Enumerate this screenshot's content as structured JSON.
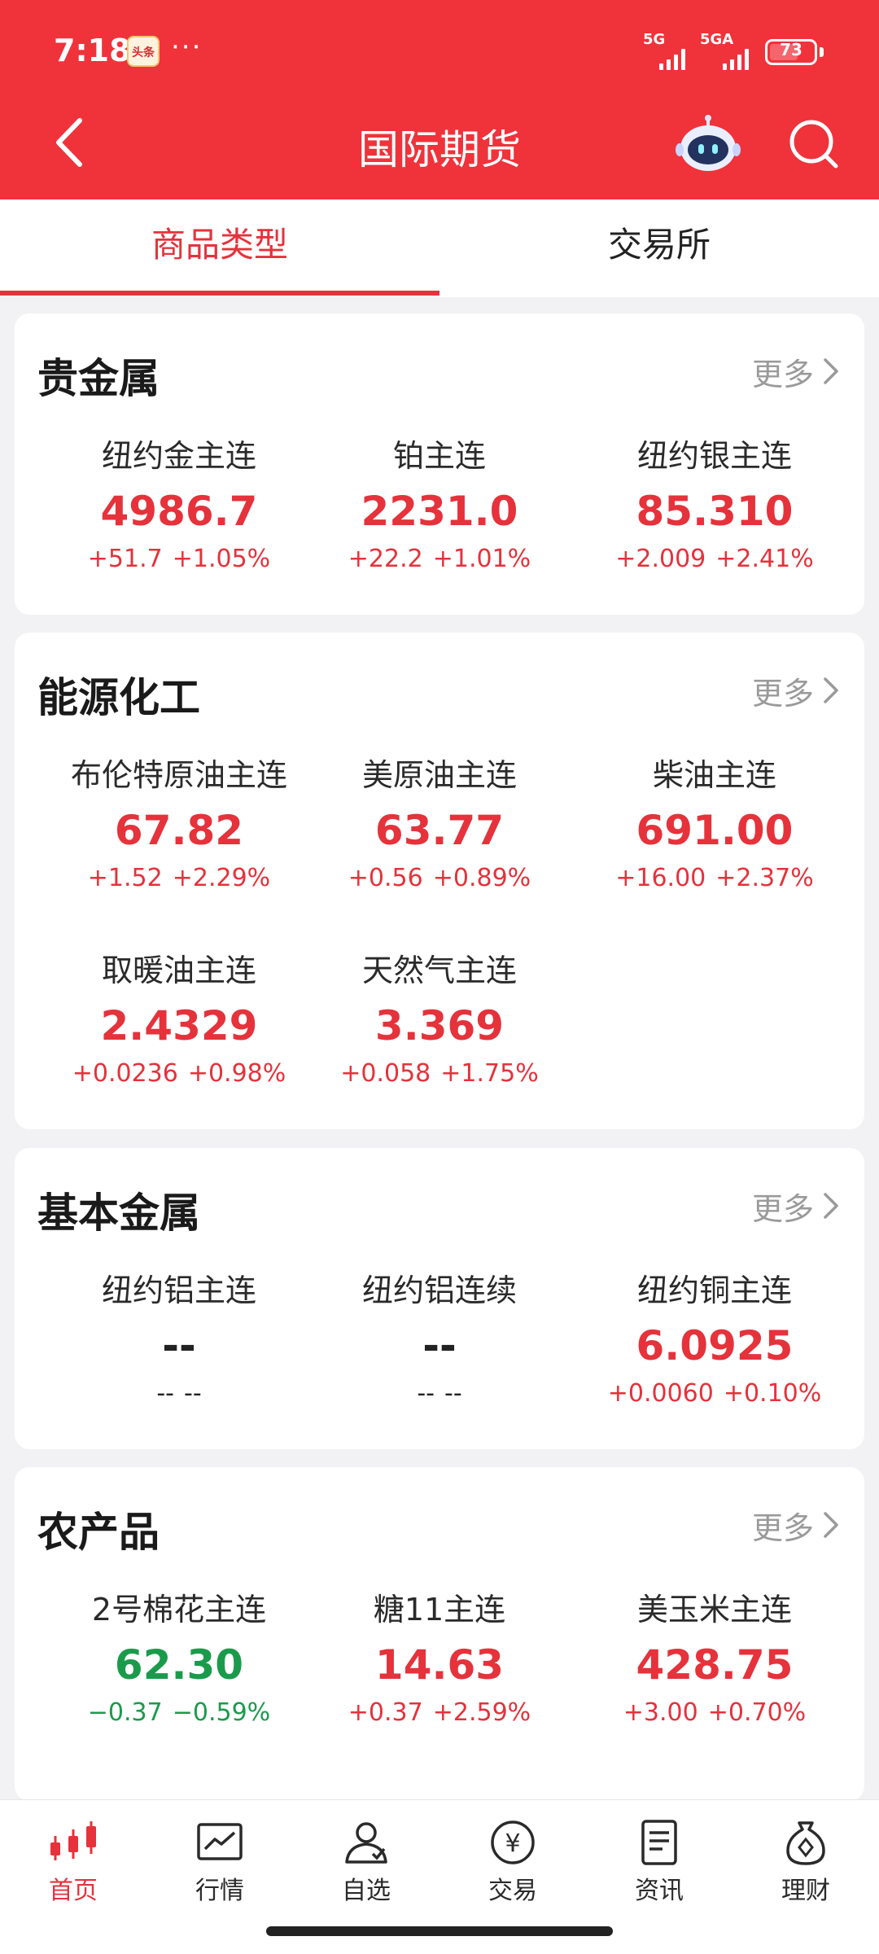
{
  "status_bar": {
    "time": "7:18",
    "app_badge": "头条",
    "dots": "···",
    "signal1": "5G",
    "signal2": "5GA",
    "battery": "73"
  },
  "header": {
    "title": "国际期货"
  },
  "tabs": [
    {
      "label": "商品类型",
      "active": true
    },
    {
      "label": "交易所",
      "active": false
    }
  ],
  "colors": {
    "up": "#e5323b",
    "down": "#1a9b4b",
    "flat": "#222222",
    "accent": "#f0323b"
  },
  "sections": [
    {
      "title": "贵金属",
      "more": "更多",
      "items": [
        {
          "name": "纽约金主连",
          "price": "4986.7",
          "change": "+51.7",
          "pct": "+1.05%",
          "trend": "up"
        },
        {
          "name": "铂主连",
          "price": "2231.0",
          "change": "+22.2",
          "pct": "+1.01%",
          "trend": "up"
        },
        {
          "name": "纽约银主连",
          "price": "85.310",
          "change": "+2.009",
          "pct": "+2.41%",
          "trend": "up"
        }
      ]
    },
    {
      "title": "能源化工",
      "more": "更多",
      "items": [
        {
          "name": "布伦特原油主连",
          "price": "67.82",
          "change": "+1.52",
          "pct": "+2.29%",
          "trend": "up"
        },
        {
          "name": "美原油主连",
          "price": "63.77",
          "change": "+0.56",
          "pct": "+0.89%",
          "trend": "up"
        },
        {
          "name": "柴油主连",
          "price": "691.00",
          "change": "+16.00",
          "pct": "+2.37%",
          "trend": "up"
        },
        {
          "name": "取暖油主连",
          "price": "2.4329",
          "change": "+0.0236",
          "pct": "+0.98%",
          "trend": "up"
        },
        {
          "name": "天然气主连",
          "price": "3.369",
          "change": "+0.058",
          "pct": "+1.75%",
          "trend": "up"
        }
      ]
    },
    {
      "title": "基本金属",
      "more": "更多",
      "items": [
        {
          "name": "纽约铝主连",
          "price": "--",
          "change": "--",
          "pct": "--",
          "trend": "flat"
        },
        {
          "name": "纽约铝连续",
          "price": "--",
          "change": "--",
          "pct": "--",
          "trend": "flat"
        },
        {
          "name": "纽约铜主连",
          "price": "6.0925",
          "change": "+0.0060",
          "pct": "+0.10%",
          "trend": "up"
        }
      ]
    },
    {
      "title": "农产品",
      "more": "更多",
      "items": [
        {
          "name": "2号棉花主连",
          "price": "62.30",
          "change": "−0.37",
          "pct": "−0.59%",
          "trend": "down"
        },
        {
          "name": "糖11主连",
          "price": "14.63",
          "change": "+0.37",
          "pct": "+2.59%",
          "trend": "up"
        },
        {
          "name": "美玉米主连",
          "price": "428.75",
          "change": "+3.00",
          "pct": "+0.70%",
          "trend": "up"
        }
      ]
    }
  ],
  "bottom_nav": [
    {
      "label": "首页",
      "icon": "candlestick-icon",
      "active": true
    },
    {
      "label": "行情",
      "icon": "chart-icon",
      "active": false
    },
    {
      "label": "自选",
      "icon": "user-select-icon",
      "active": false
    },
    {
      "label": "交易",
      "icon": "yuan-icon",
      "active": false
    },
    {
      "label": "资讯",
      "icon": "document-icon",
      "active": false
    },
    {
      "label": "理财",
      "icon": "money-bag-icon",
      "active": false
    }
  ]
}
